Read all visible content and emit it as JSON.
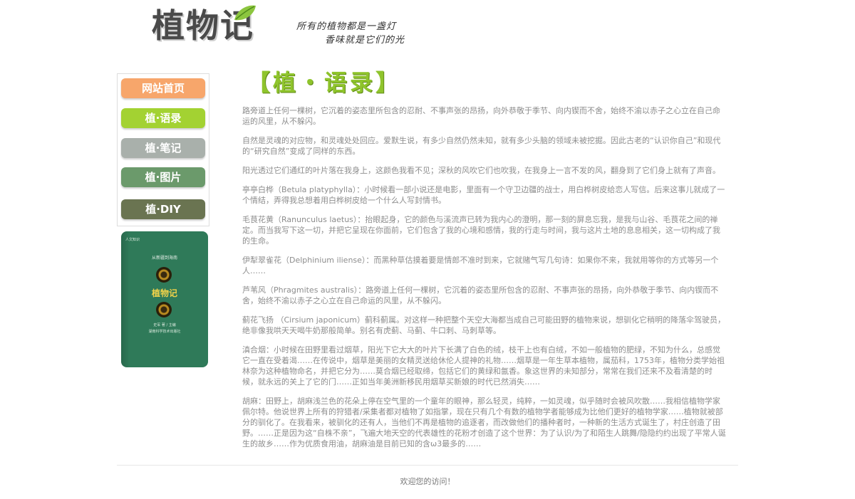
{
  "header": {
    "logo_text": "植物记",
    "slogan_line1": "所有的植物都是一盏灯",
    "slogan_line2": "香味就是它们的光"
  },
  "nav": {
    "items": [
      {
        "label": "网站首页",
        "color": "#f7a66b"
      },
      {
        "label": "植·语录",
        "color": "#a3d232"
      },
      {
        "label": "植·笔记",
        "color": "#a9b0ab"
      },
      {
        "label": "植·图片",
        "color": "#6b9a6b"
      },
      {
        "label": "植·DIY",
        "color": "#6a7451"
      }
    ]
  },
  "book": {
    "corner": "人文知识",
    "subtitle": "从新疆到海南",
    "title": "植物记",
    "author": "史军 著 / 主编",
    "press": "湖南科学技术出版社"
  },
  "main": {
    "heading": "【植・语录】",
    "paragraphs": [
      "路旁道上任何一棵树，它沉着的姿态里所包含的忍耐、不事声张的昂扬，向外恭敬于季节、向内锲而不舍，始终不渝以赤子之心立在自己命运的风里，从不躲闪。",
      "自然是灵魂的对应物，和灵魂处处回应。爱默生说，有多少自然仍然未知，就有多少头脑的领域未被挖掘。因此古老的“认识你自己”和现代的“研究自然”变成了同样的东西。",
      " 阳光透过它们通红的叶片落在我身上，这颜色我看不见；深秋的风吹它们也吹我，在我身上一言不发的风，翻身到了它们身上就有了声音。",
      "亭亭白桦（Betula platyphylla）：小时候看一部小说还是电影，里面有一个守卫边疆的战士，用白桦树皮给恋人写信。后来这事儿就成了一个情结，弄得我总想着用白桦树皮给一个什么人写封情书。",
      "毛茛花黄（Ranunculus laetus）：抬眼起身，它的颜色与溪流声已转为我内心的澄明，那一刻的屏息忘我，是我与山谷、毛茛花之间的禅定。而当我写下这一切，并把它呈现在你面前，它们包含了我的心境和感情，我的行走与时间，我与这片土地的息息相关，这一切构成了我的生命。",
      "伊犁翠雀花（Delphinium iliense）：而黑种草估摸着要是情郎不准时到来，它就赌气写几句诗：如果你不来，我就用等你的方式等另一个人……",
      "芦苇风（Phragmites australis）：路旁道上任何一棵树，它沉着的姿态里所包含的忍耐、不事声张的昂扬，向外恭敬于季节、向内锲而不舍，始终不渝以赤子之心立在自己命运的风里，从不躲闪。",
      "蓟花飞扬 （Cirsium japonicum）蓟科蓟属。对这样一种把整个天空大海都当成自己可能田野的植物来说，想驯化它稍明的降落伞驾驶员，绝非像我哄天天喝牛奶那般简单。别名有虎蓟、马蓟、牛口刺、马刺草等。",
      "滇合烟：小时候在田野里看过烟草，阳光下它大大的叶片下长满了白色的绒，枝干上也有白绒，不如一般植物的肥绿，不知为什么，总感觉它一直在受着渴……在传说中，烟草是美丽的女精灵送给休伦人提神的礼物……烟草是一年生草本植物，属茄科，1753年，植物分类学始祖林奈为这种植物命名，并把它分为……莫合烟已经取缔，包括它们的黄绿和氤香。象这世界的未知部分，常常在我们还来不及看清楚的时候，就永远的关上了它的门……正如当年美洲新移民用烟草买新娘的时代已然消失……",
      " 胡麻：田野上，胡麻浅兰色的花朵上停在空气里的一个童年的眼神，那么轻灵，纯粹，一如灵魂，似乎随时会被风吹散……我相信植物学家佩尔特。他说世界上所有的狩猎者/采集者都对植物了如指掌，现在只有几个有数的植物学者能够成为比他们更好的植物学家……植物就被部分的驯化了。在我看来，被驯化的还有人，当他们不再是植物的追逐者，而改做他们的播种者时，一种新的生活方式诞生了，村庄创造了田野。……正是因为这“自株不亲”，飞遍大地天空的代表雄性的花粉才创造了这个世界：为了认识/为了和陌生人跳舞/隐隐约约出现了平常人诞生的故乡……作为优质食用油，胡麻油是目前已知的含ω3最多的……"
    ]
  },
  "footer": {
    "text": "欢迎您的访问！"
  }
}
